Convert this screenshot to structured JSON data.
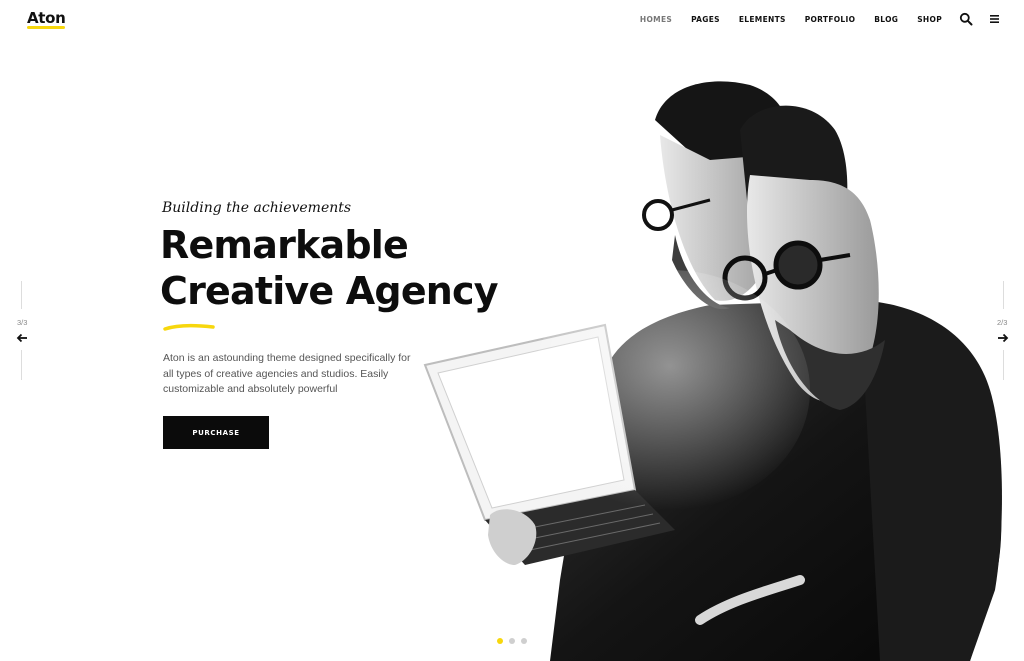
{
  "brand": {
    "name": "Aton",
    "accent": "#f7d70d"
  },
  "nav": {
    "items": [
      {
        "label": "HOMES",
        "active": true
      },
      {
        "label": "PAGES"
      },
      {
        "label": "ELEMENTS"
      },
      {
        "label": "PORTFOLIO"
      },
      {
        "label": "BLOG"
      },
      {
        "label": "SHOP"
      }
    ],
    "search_icon": "search-icon",
    "menu_icon": "hamburger-menu-icon"
  },
  "hero": {
    "tagline": "Building the achievements",
    "headline_line1": "Remarkable",
    "headline_line2": "Creative Agency",
    "description": "Aton is an astounding theme designed specifically for all types of creative agencies and studios. Easily customizable and absolutely powerful",
    "button_label": "PURCHASE",
    "image": "black-and-white double-exposure of bearded man with glasses holding laptop"
  },
  "slider": {
    "prev_count": "3/3",
    "next_count": "2/3",
    "prev_icon": "arrow-left-icon",
    "next_icon": "arrow-right-icon",
    "dots": [
      {
        "active": true
      },
      {
        "active": false
      },
      {
        "active": false
      }
    ]
  }
}
